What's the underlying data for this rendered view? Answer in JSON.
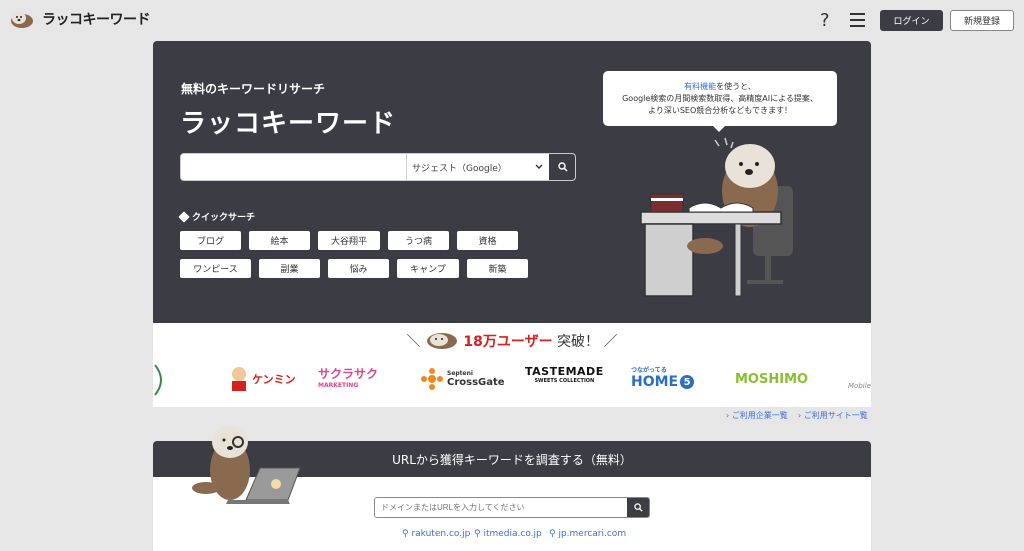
{
  "header": {
    "logo_text": "ラッコキーワード",
    "help_label": "?",
    "login_label": "ログイン",
    "signup_label": "新規登録"
  },
  "hero": {
    "subtitle": "無料のキーワードリサーチ",
    "title": "ラッコキーワード",
    "search_placeholder": "",
    "search_source": "サジェスト（Google）",
    "quick_search_label": "クイックサーチ",
    "chips": [
      "ブログ",
      "絵本",
      "大谷翔平",
      "うつ病",
      "資格",
      "ワンピース",
      "副業",
      "悩み",
      "キャンプ",
      "新築"
    ],
    "bubble": {
      "link": "有料機能",
      "line1_rest": "を使うと、",
      "line2": "Google検索の月間検索数取得、高精度AIによる提案、",
      "line3": "より深いSEO競合分析などもできます！"
    }
  },
  "users": {
    "prefix": "＼",
    "count": "18万ユーザー",
    "suffix": "突破！",
    "end": "／",
    "logos": [
      "ケンミン",
      "サクラサク",
      "MARKETING",
      "Septeni",
      "CrossGate",
      "TASTEMADE",
      "SWEETS COLLECTION",
      "つながってる",
      "HOME",
      "5",
      "MOSHIMO",
      "Mobile"
    ]
  },
  "links": {
    "companies": "ご利用企業一覧",
    "sites": "ご利用サイト一覧"
  },
  "url_section": {
    "title": "URLから獲得キーワードを調査する（無料）",
    "placeholder": "ドメインまたはURLを入力してください",
    "examples": [
      "rakuten.co.jp",
      "itmedia.co.jp",
      "jp.mercari.com"
    ]
  },
  "colors": {
    "dark": "#3c3d44",
    "accent_red": "#d62121",
    "link_blue": "#3a6fd8"
  }
}
